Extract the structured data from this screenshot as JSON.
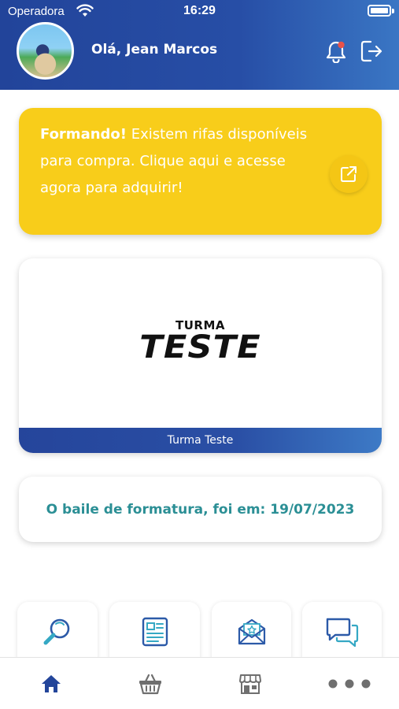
{
  "status_bar": {
    "carrier": "Operadora",
    "time": "16:29"
  },
  "header": {
    "greeting": "Olá, Jean Marcos",
    "notification_badge_color": "#e8524a"
  },
  "notice": {
    "bold_text": "Formando!",
    "text": " Existem rifas disponíveis para compra. Clique aqui e acesse agora para adquirir!"
  },
  "class_card": {
    "logo_small": "TURMA",
    "logo_big": "TESTE",
    "name": "Turma Teste"
  },
  "info_card": {
    "text": "O baile de formatura, foi em: 19/07/2023"
  },
  "shortcuts": [
    {
      "icon": "search-icon"
    },
    {
      "icon": "newspaper-icon"
    },
    {
      "icon": "mail-star-icon"
    },
    {
      "icon": "chat-icon"
    }
  ],
  "bottom_nav": [
    {
      "icon": "home-icon",
      "active": true
    },
    {
      "icon": "basket-icon",
      "active": false
    },
    {
      "icon": "store-icon",
      "active": false
    },
    {
      "icon": "more-icon",
      "active": false
    }
  ],
  "colors": {
    "primary": "#25459b",
    "accent_yellow": "#f8cd1a",
    "teal_text": "#2b8f95"
  }
}
